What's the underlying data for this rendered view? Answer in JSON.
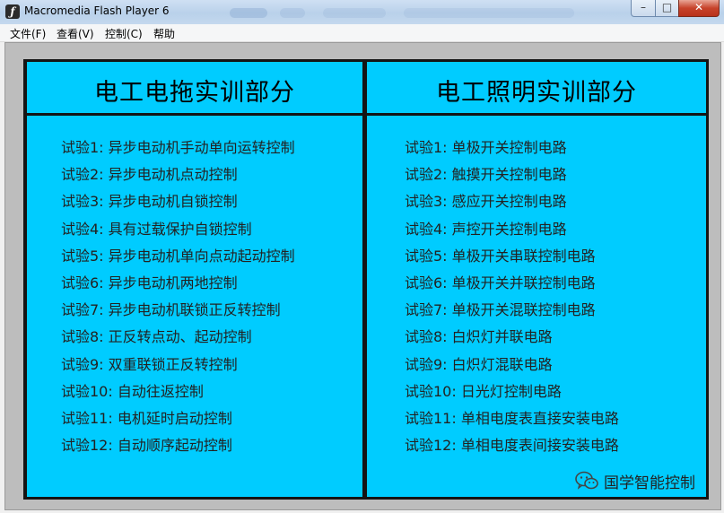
{
  "window": {
    "title": "Macromedia Flash Player 6",
    "buttons": {
      "minimize": "–",
      "maximize": "□",
      "close": "✕"
    }
  },
  "menu": {
    "items": [
      "文件(F)",
      "查看(V)",
      "控制(C)",
      "帮助"
    ]
  },
  "left_panel": {
    "title": "电工电拖实训部分",
    "items": [
      "试验1:  异步电动机手动单向运转控制",
      "试验2:  异步电动机点动控制",
      "试验3: 异步电动机自锁控制",
      "试验4:  具有过载保护自锁控制",
      "试验5:  异步电动机单向点动起动控制",
      "试验6:  异步电动机两地控制",
      "试验7:  异步电动机联锁正反转控制",
      "试验8:  正反转点动、起动控制",
      "试验9:  双重联锁正反转控制",
      "试验10:  自动往返控制",
      "试验11:  电机延时启动控制",
      "试验12:  自动顺序起动控制"
    ]
  },
  "right_panel": {
    "title": "电工照明实训部分",
    "items": [
      "试验1:  单极开关控制电路",
      "试验2:  触摸开关控制电路",
      "试验3:  感应开关控制电路",
      "试验4:  声控开关控制电路",
      "试验5:  单极开关串联控制电路",
      "试验6:  单极开关并联控制电路",
      "试验7:  单极开关混联控制电路",
      "试验8:  白炽灯并联电路",
      "试验9:  白炽灯混联电路",
      "试验10:  日光灯控制电路",
      "试验11:  单相电度表直接安装电路",
      "试验12:  单相电度表间接安装电路"
    ]
  },
  "watermark": {
    "text": "国学智能控制",
    "icon": "wechat-icon"
  },
  "colors": {
    "panel": "#00ccff",
    "stage_border": "#141414",
    "frame": "#bdbdbd"
  }
}
